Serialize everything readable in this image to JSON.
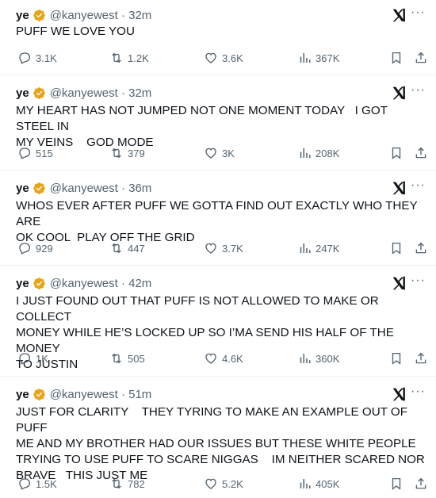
{
  "colors": {
    "text": "#0f1419",
    "muted": "#536471",
    "badge": "#e8a317",
    "divider": "#eff3f4"
  },
  "icons": [
    "verified-badge-icon",
    "grok-icon",
    "more-icon",
    "reply-icon",
    "retweet-icon",
    "like-icon",
    "views-icon",
    "bookmark-icon",
    "share-icon"
  ],
  "tweets": [
    {
      "name": "ye",
      "handle_time": "@kanyewest · 32m",
      "text": "PUFF WE LOVE YOU",
      "more": "···",
      "replies": "3.1K",
      "retweets": "1.2K",
      "likes": "3.6K",
      "views": "367K"
    },
    {
      "name": "ye",
      "handle_time": "@kanyewest · 32m",
      "text": "MY HEART HAS NOT JUMPED NOT ONE MOMENT TODAY   I GOT STEEL IN\nMY VEINS    GOD MODE",
      "more": "···",
      "replies": "515",
      "retweets": "379",
      "likes": "3K",
      "views": "208K"
    },
    {
      "name": "ye",
      "handle_time": "@kanyewest · 36m",
      "text": "WHOS EVER AFTER PUFF WE GOTTA FIND OUT EXACTLY WHO THEY ARE\nOK COOL  PLAY OFF THE GRID",
      "more": "···",
      "replies": "929",
      "retweets": "447",
      "likes": "3.7K",
      "views": "247K"
    },
    {
      "name": "ye",
      "handle_time": "@kanyewest · 42m",
      "text": "I JUST FOUND OUT THAT PUFF IS NOT ALLOWED TO MAKE OR COLLECT\nMONEY WHILE HE’S LOCKED UP SO I’MA SEND HIS HALF OF THE  MONEY\nTO JUSTIN",
      "more": "···",
      "replies": "1K",
      "retweets": "505",
      "likes": "4.6K",
      "views": "360K"
    },
    {
      "name": "ye",
      "handle_time": "@kanyewest · 51m",
      "text": "JUST FOR CLARITY    THEY TYRING TO MAKE AN EXAMPLE OUT OF PUFF\nME AND MY BROTHER HAD OUR ISSUES BUT THESE WHITE PEOPLE\nTRYING TO USE PUFF TO SCARE NIGGAS    IM NEITHER SCARED NOR\nBRAVE   THIS JUST ME",
      "more": "···",
      "replies": "1.5K",
      "retweets": "782",
      "likes": "5.2K",
      "views": "405K"
    }
  ]
}
